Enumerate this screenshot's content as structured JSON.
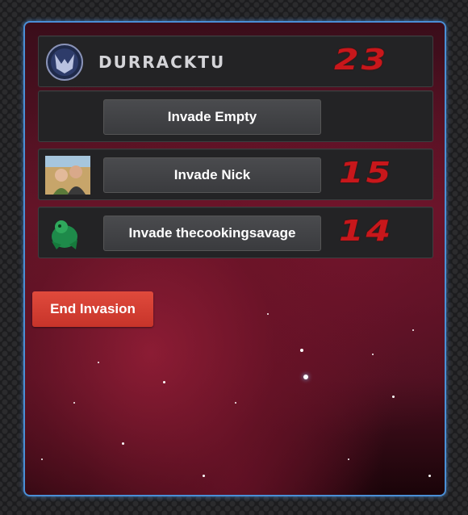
{
  "player": {
    "name": "DURRACKTU",
    "score": "23"
  },
  "slots": [
    {
      "button_label": "Invade Empty",
      "score": ""
    },
    {
      "button_label": "Invade Nick",
      "score": "15"
    },
    {
      "button_label": "Invade thecookingsavage",
      "score": "14"
    }
  ],
  "actions": {
    "end_label": "End Invasion"
  },
  "colors": {
    "accent_border": "#4a8fd6",
    "score": "#c8171b",
    "end_button": "#d83e31"
  }
}
